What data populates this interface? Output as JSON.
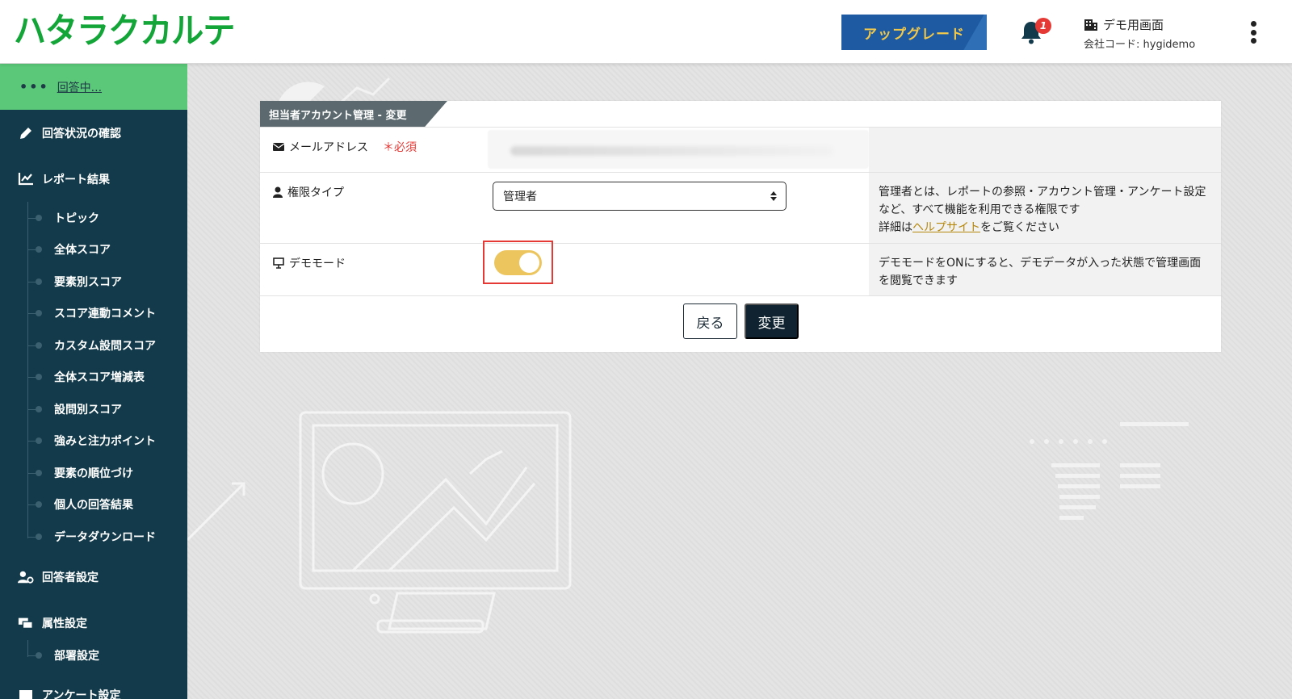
{
  "header": {
    "logo": "ハタラクカルテ",
    "upgrade_label": "アップグレード",
    "notification_count": "1",
    "company_name": "デモ用画面",
    "company_code": "会社コード: hygidemo"
  },
  "sidebar": {
    "active_dots": "•••",
    "active_label": "回答中...",
    "items": [
      {
        "label": "回答状況の確認",
        "icon": "pencil-icon"
      },
      {
        "label": "レポート結果",
        "icon": "chart-icon"
      }
    ],
    "report_subitems": [
      "トピック",
      "全体スコア",
      "要素別スコア",
      "スコア連動コメント",
      "カスタム設問スコア",
      "全体スコア増減表",
      "設問別スコア",
      "強みと注力ポイント",
      "要素の順位づけ",
      "個人の回答結果",
      "データダウンロード"
    ],
    "respondent_settings": "回答者設定",
    "attribute_settings": "属性設定",
    "attribute_subitems": [
      "部署設定"
    ],
    "cut_off_item": "アンケート設定"
  },
  "card": {
    "title": "担当者アカウント管理 - 変更",
    "email": {
      "label": "メールアドレス",
      "required": "＊必須"
    },
    "role": {
      "label": "権限タイプ",
      "value": "管理者",
      "help_line1": "管理者とは、レポートの参照・アカウント管理・アンケート設定など、すべて機能を利用できる権限です",
      "help_prefix": "詳細は",
      "help_link": "ヘルプサイト",
      "help_suffix": "をご覧ください"
    },
    "demo": {
      "label": "デモモード",
      "enabled": true,
      "help": "デモモードをONにすると、デモデータが入った状態で管理画面を閲覧できます"
    },
    "back_label": "戻る",
    "submit_label": "変更"
  },
  "colors": {
    "brand_green": "#13a538",
    "sidebar_bg": "#123a4a",
    "active_green": "#5ac878",
    "upgrade_blue": "#1d5aa1",
    "upgrade_text": "#f2c84b",
    "toggle_on": "#ecc55e",
    "highlight_red": "#e53935",
    "link_gold": "#b5870c"
  }
}
